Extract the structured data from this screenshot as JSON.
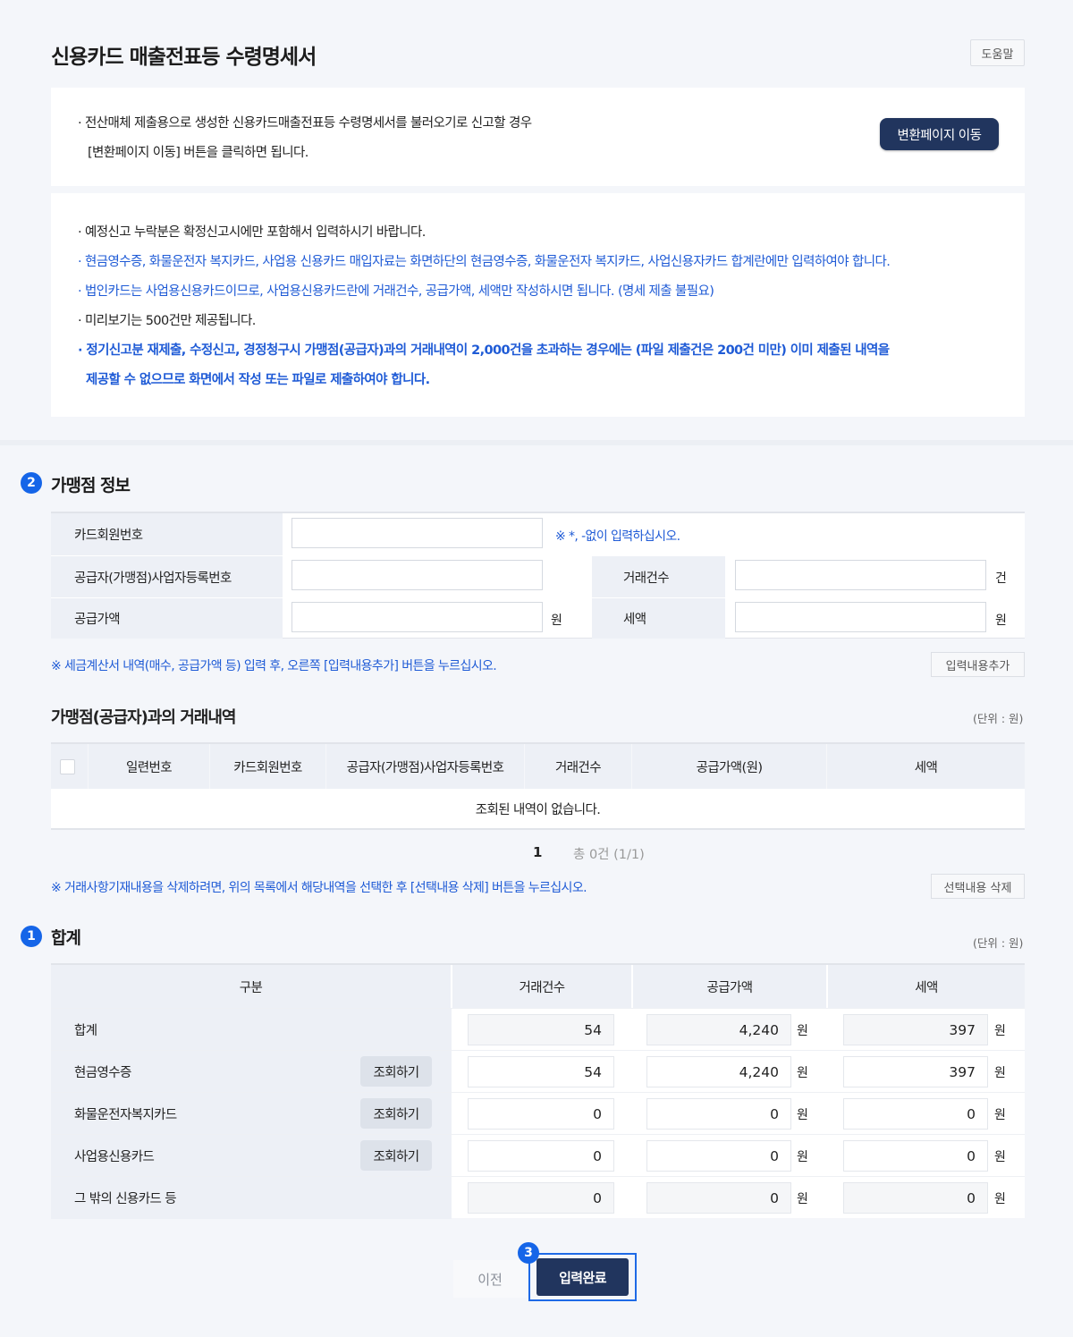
{
  "header": {
    "title": "신용카드 매출전표등 수령명세서",
    "help_label": "도움말"
  },
  "notice1": {
    "line1": "· 전산매체 제출용으로 생성한 신용카드매출전표등 수령명세서를 불러오기로 신고할 경우",
    "line2": "[변환페이지 이동] 버튼을 클릭하면 됩니다.",
    "button": "변환페이지 이동"
  },
  "notice2": {
    "items": [
      "· 예정신고 누락분은 확정신고시에만 포함해서 입력하시기 바랍니다.",
      "· 현금영수증, 화물운전자 복지카드, 사업용 신용카드 매입자료는 화면하단의 현금영수증, 화물운전자 복지카드, 사업신용자카드 합계란에만 입력하여야 합니다.",
      "· 법인카드는 사업용신용카드이므로, 사업용신용카드란에 거래건수, 공급가액, 세액만 작성하시면 됩니다. (명세 제출 불필요)",
      "·  미리보기는 500건만 제공됩니다.",
      "· 정기신고분 재제출, 수정신고, 경정청구시 가맹점(공급자)과의 거래내역이 2,000건을 초과하는 경우에는 (파일 제출건은 200건 미만) 이미 제출된 내역을",
      "제공할 수 없으므로 화면에서 작성 또는 파일로 제출하여야 합니다."
    ]
  },
  "merchant": {
    "step": "2",
    "title": "가맹점 정보",
    "card_no_label": "카드회원번호",
    "card_no_hint": "※ *, -없이 입력하십시오.",
    "biz_no_label": "공급자(가맹점)사업자등록번호",
    "count_label": "거래건수",
    "count_unit": "건",
    "supply_label": "공급가액",
    "supply_unit": "원",
    "tax_label": "세액",
    "tax_unit": "원",
    "add_hint": "※ 세금계산서 내역(매수, 공급가액 등) 입력 후, 오른쪽 [입력내용추가] 버튼을 누르십시오.",
    "add_button": "입력내용추가"
  },
  "history": {
    "title": "가맹점(공급자)과의 거래내역",
    "unit_note": "(단위 : 원)",
    "columns": [
      "일련번호",
      "카드회원번호",
      "공급자(가맹점)사업자등록번호",
      "거래건수",
      "공급가액(원)",
      "세액"
    ],
    "empty": "조회된 내역이 없습니다.",
    "page": "1",
    "total": "총 0건 (1/1)",
    "delete_hint": "※ 거래사항기재내용을 삭제하려면, 위의 목록에서 해당내역을 선택한 후 [선택내용 삭제] 버튼을 누르십시오.",
    "delete_button": "선택내용 삭제"
  },
  "summary": {
    "step": "1",
    "title": "합계",
    "unit_note": "(단위 : 원)",
    "columns": [
      "구분",
      "거래건수",
      "공급가액",
      "세액"
    ],
    "query_label": "조회하기",
    "won": "원",
    "rows": [
      {
        "label": "합계",
        "count": "54",
        "supply": "4,240",
        "tax": "397"
      },
      {
        "label": "현금영수증",
        "count": "54",
        "supply": "4,240",
        "tax": "397"
      },
      {
        "label": "화물운전자복지카드",
        "count": "0",
        "supply": "0",
        "tax": "0"
      },
      {
        "label": "사업용신용카드",
        "count": "0",
        "supply": "0",
        "tax": "0"
      },
      {
        "label": "그 밖의 신용카드 등",
        "count": "0",
        "supply": "0",
        "tax": "0"
      }
    ]
  },
  "footer": {
    "prev": "이전",
    "done": "입력완료",
    "step": "3"
  }
}
